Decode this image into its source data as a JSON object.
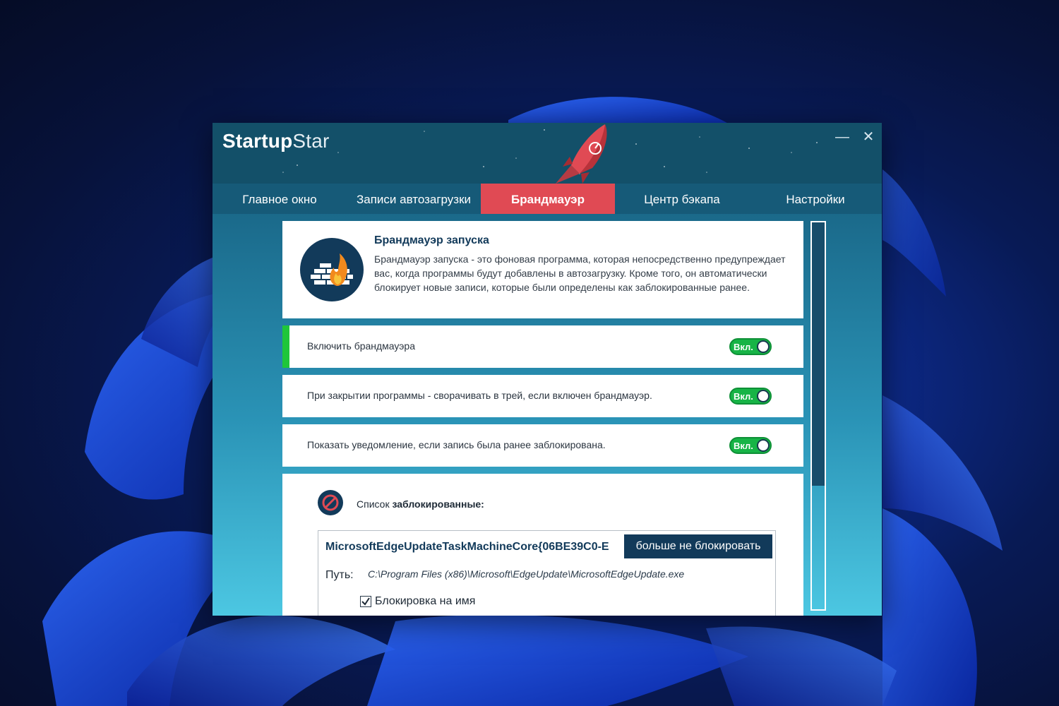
{
  "app": {
    "logo_bold": "Startup",
    "logo_light": "Star"
  },
  "window_controls": {
    "minimize": "—",
    "close": "✕"
  },
  "tabs": [
    {
      "label": "Главное окно"
    },
    {
      "label": "Записи автозагрузки"
    },
    {
      "label": "Брандмауэр",
      "active": true
    },
    {
      "label": "Центр бэкапа"
    },
    {
      "label": "Настройки"
    }
  ],
  "info": {
    "title": "Брандмауэр запуска",
    "text": "Брандмауэр запуска - это фоновая программа, которая непосредственно предупреждает вас, когда программы будут добавлены в автозагрузку. Кроме того, он автоматически блокирует новые записи, которые были определены как заблокированные ранее.",
    "icon": "firewall-icon"
  },
  "options": [
    {
      "label": "Включить брандмауэра",
      "toggle": "Вкл.",
      "on": true
    },
    {
      "label": "При закрытии программы - сворачивать в трей, если включен брандмауэр.",
      "toggle": "Вкл.",
      "on": true
    },
    {
      "label": "Показать уведомление, если запись была ранее заблокирована.",
      "toggle": "Вкл.",
      "on": true
    }
  ],
  "blocked": {
    "label_prefix": "Список",
    "label_bold": "заблокированные:",
    "icon": "block-icon",
    "entry": {
      "name": "MicrosoftEdgeUpdateTaskMachineCore{06BE39C0-E",
      "unblock_button": "больше не блокировать",
      "path_label": "Путь:",
      "path": "C:\\Program Files (x86)\\Microsoft\\EdgeUpdate\\MicrosoftEdgeUpdate.exe",
      "checkbox_label": "Блокировка на имя",
      "checkbox_checked": true
    }
  },
  "colors": {
    "accent_red": "#e04a54",
    "toggle_green": "#17b446",
    "navy": "#123a5a"
  }
}
